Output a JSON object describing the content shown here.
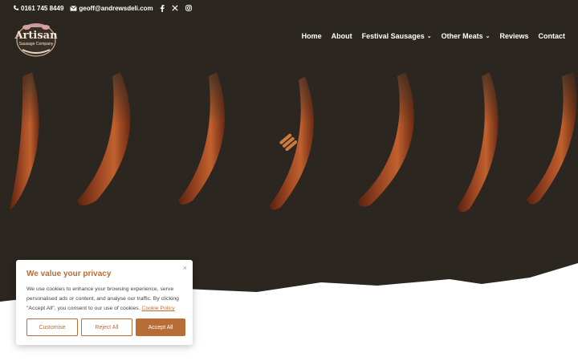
{
  "topbar": {
    "phone": "0161 745 8449",
    "email": "geoff@andrewsdeli.com",
    "socials": [
      "facebook-icon",
      "x-icon",
      "instagram-icon"
    ]
  },
  "logo": {
    "line1": "Artisan",
    "line2": "Sausage Company"
  },
  "nav": {
    "items": [
      {
        "label": "Home",
        "dropdown": false
      },
      {
        "label": "About",
        "dropdown": false
      },
      {
        "label": "Festival Sausages",
        "dropdown": true
      },
      {
        "label": "Other Meats",
        "dropdown": true
      },
      {
        "label": "Reviews",
        "dropdown": false
      },
      {
        "label": "Contact",
        "dropdown": false
      }
    ]
  },
  "cookie": {
    "title": "We value your privacy",
    "body": "We use cookies to enhance your browsing experience, serve personalised ads or content, and analyse our traffic. By clicking \"Accept All\", you consent to our use of cookies.",
    "policy_link": "Cookie Policy",
    "close": "×",
    "customise": "Customise",
    "reject": "Reject All",
    "accept": "Accept All"
  },
  "colors": {
    "background": "#2c2620",
    "accent": "#b86c36",
    "sausage": "#8a3a1c"
  }
}
